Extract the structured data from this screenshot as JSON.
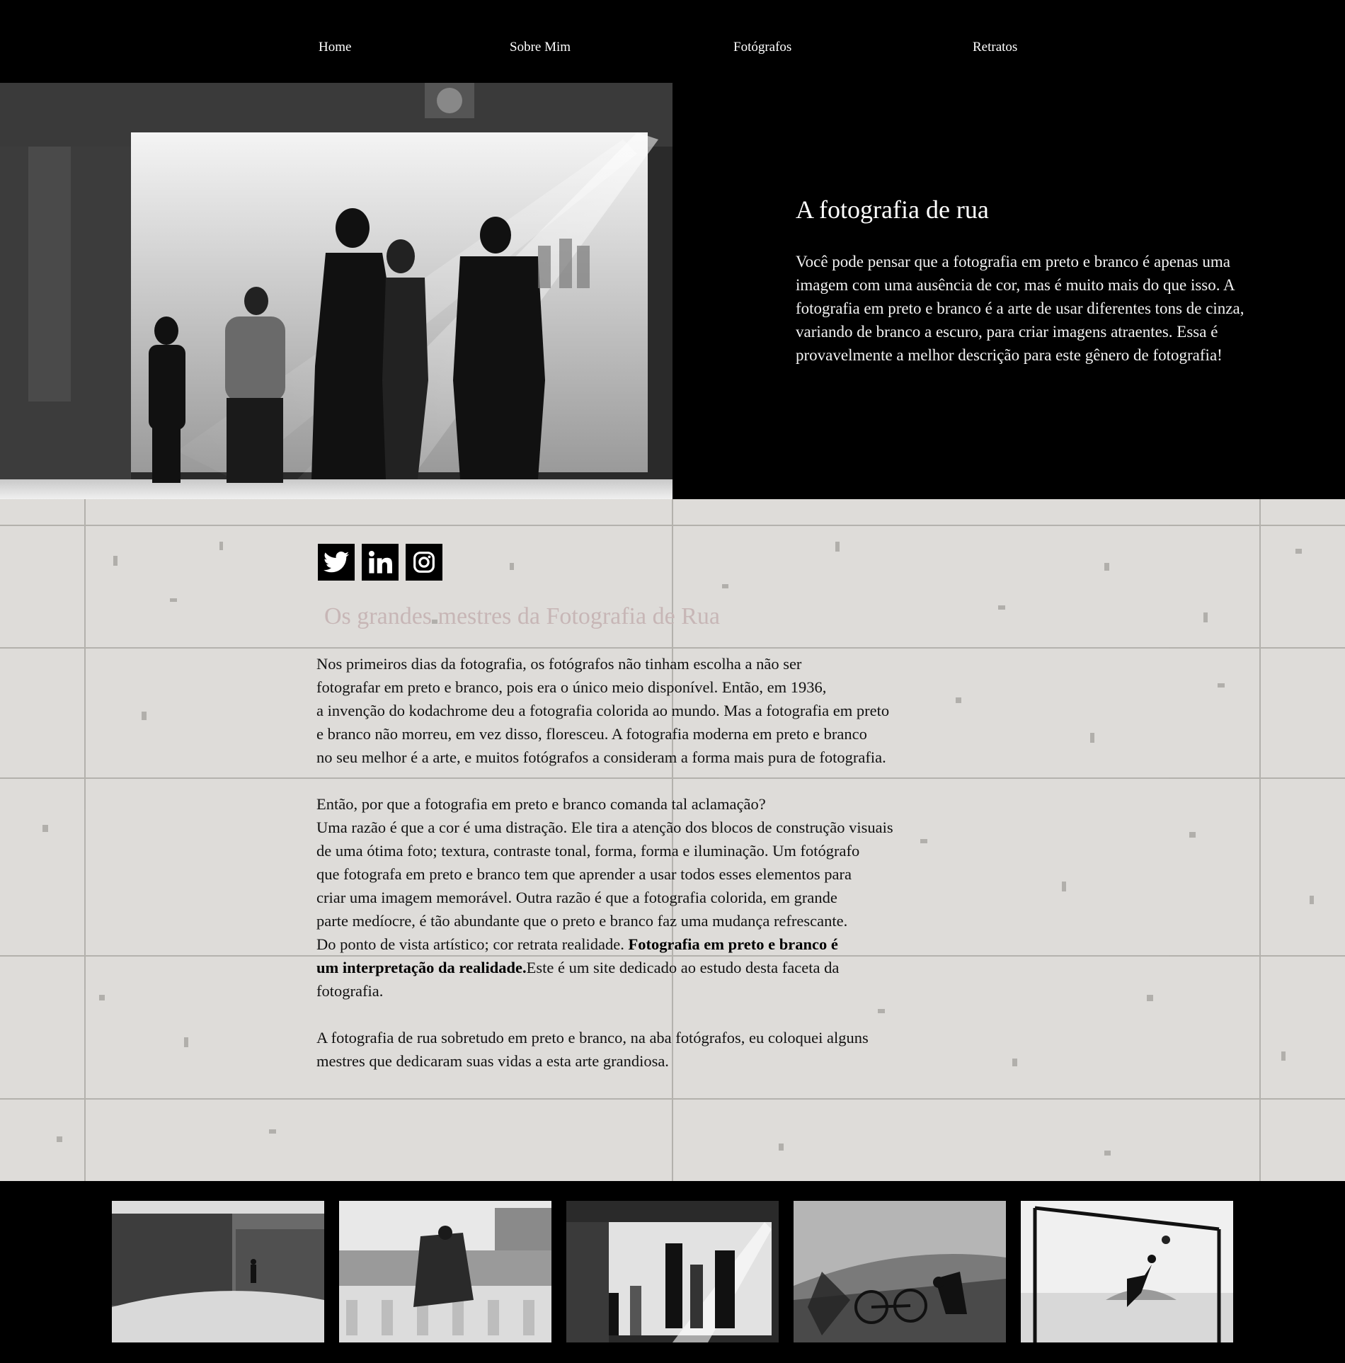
{
  "nav": {
    "items": [
      {
        "label": "Home"
      },
      {
        "label": "Sobre Mim"
      },
      {
        "label": "Fotógrafos"
      },
      {
        "label": "Retratos"
      }
    ]
  },
  "hero": {
    "title": "A fotografia de rua",
    "body": "Você pode pensar que a fotografia em preto e branco é apenas uma imagem com uma ausência de cor, mas é muito mais do que isso. A fotografia em preto e branco é a arte de usar diferentes tons de cinza, variando de branco a escuro, para criar imagens atraentes. Essa é provavelmente a melhor descrição para este gênero de fotografia!"
  },
  "social": {
    "icons": [
      "twitter-icon",
      "linkedin-icon",
      "instagram-icon"
    ]
  },
  "masters": {
    "title": "Os grandes mestres da Fotografia de Rua",
    "p1": [
      "Nos primeiros dias da fotografia, os fotógrafos não tinham escolha a não ser",
      "fotografar em preto e branco, pois era o único meio disponível. Então, em 1936,",
      "a invenção do kodachrome deu a fotografia colorida ao mundo. Mas a fotografia em preto",
      " e branco não morreu, em vez disso, floresceu. A fotografia moderna em preto e branco",
      "no seu melhor é a arte, e muitos fotógrafos a consideram a forma mais pura de fotografia."
    ],
    "p2": [
      "Então, por que a fotografia em preto e branco comanda tal aclamação?",
      "Uma razão é que a cor é uma distração. Ele tira a atenção dos blocos de construção visuais",
      "de uma ótima foto; textura, contraste tonal, forma, forma e iluminação. Um fotógrafo",
      "que fotografa em preto e branco tem que aprender a usar todos esses elementos para",
      "criar uma imagem memorável. Outra razão é que a fotografia colorida, em grande",
      "parte medíocre, é tão abundante que o preto e branco faz uma mudança refrescante."
    ],
    "p2_line7_plain": "Do ponto de vista artístico; cor retrata realidade. ",
    "p2_line7_bold": "Fotografia em preto e branco é",
    "p2_line8_bold": " um interpretação da realidade.",
    "p2_line8_plain": "Este é um site dedicado ao estudo desta faceta da",
    "p2_line9": "fotografia.",
    "p3": [
      "A fotografia de rua sobretudo em preto e branco, na aba fotógrafos, eu coloquei alguns",
      " mestres que dedicaram suas vidas a esta arte grandiosa."
    ]
  },
  "colors": {
    "background": "#000000",
    "wall": "#dedcd9",
    "masters_title": "#c7b6b6"
  }
}
